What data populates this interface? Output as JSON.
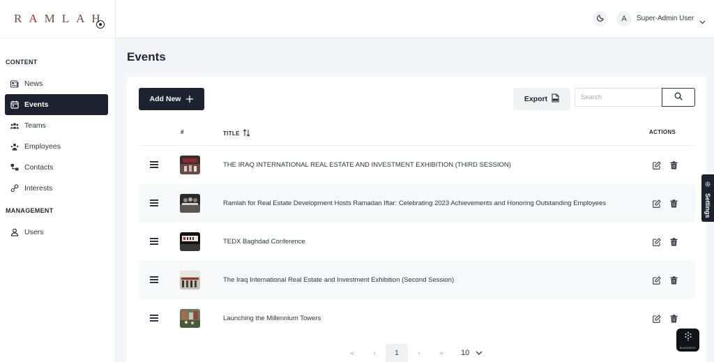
{
  "brand": {
    "logo_text_a": "R",
    "logo_text_b": "A",
    "logo_text_c": "MLAH"
  },
  "sidebar": {
    "content_label": "CONTENT",
    "management_label": "MANAGEMENT",
    "items": [
      {
        "label": "News",
        "icon": "newspaper-icon"
      },
      {
        "label": "Events",
        "icon": "calendar-icon",
        "active": true
      },
      {
        "label": "Teams",
        "icon": "teams-icon"
      },
      {
        "label": "Employees",
        "icon": "employees-icon"
      },
      {
        "label": "Contacts",
        "icon": "contacts-icon"
      },
      {
        "label": "Interests",
        "icon": "interests-icon"
      },
      {
        "label": "Users",
        "icon": "users-icon"
      }
    ]
  },
  "header": {
    "avatar_initial": "A",
    "user_name": "Super-Admin User"
  },
  "page": {
    "title": "Events"
  },
  "toolbar": {
    "add_label": "Add New",
    "export_label": "Export",
    "search_placeholder": "Search"
  },
  "table": {
    "col_index": "#",
    "col_title": "TITLE",
    "col_actions": "ACTIONS",
    "rows": [
      {
        "title": "THE IRAQ INTERNATIONAL REAL ESTATE AND INVESTMENT EXHIBITION (THIRD SESSION)"
      },
      {
        "title": "Ramlah for Real Estate Development Hosts Ramadan Iftar: Celebrating 2023 Achievements and Honoring Outstanding Employees"
      },
      {
        "title": "TEDX Baghdad Conference"
      },
      {
        "title": "The Iraq International Real Estate and Investment Exhibition (Second Session)"
      },
      {
        "title": "Launching the Millennium Towers"
      }
    ]
  },
  "pagination": {
    "first": "«",
    "prev": "‹",
    "current": "1",
    "next": "›",
    "last": "»",
    "per_page": "10"
  },
  "settings_tab": {
    "label": "Settings"
  },
  "blackbox": {
    "label": "BLACKBOX"
  },
  "colors": {
    "primary": "#1c2230",
    "background": "#f3f5f8",
    "logo_accent": "#b02a2a"
  }
}
